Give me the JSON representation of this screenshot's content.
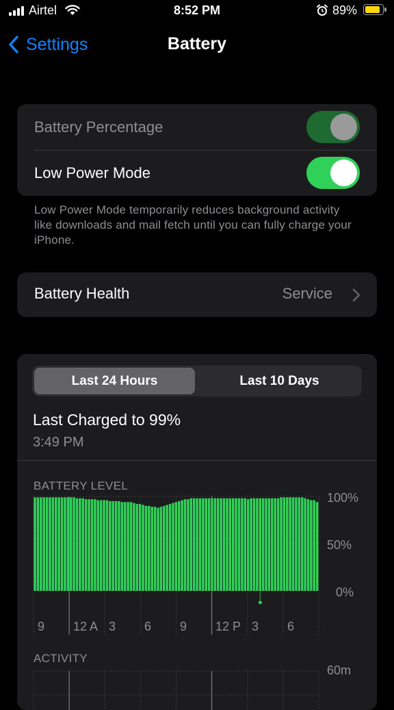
{
  "status_bar": {
    "carrier": "Airtel",
    "time": "8:52 PM",
    "battery_percent": "89%",
    "battery_level": 0.89,
    "battery_color": "#ffd60a"
  },
  "nav": {
    "back_label": "Settings",
    "title": "Battery"
  },
  "settings": {
    "battery_percentage_label": "Battery Percentage",
    "battery_percentage_enabled": true,
    "battery_percentage_disabled_state": true,
    "low_power_mode_label": "Low Power Mode",
    "low_power_mode_enabled": true,
    "low_power_note": "Low Power Mode temporarily reduces background activity like downloads and mail fetch until you can fully charge your iPhone.",
    "battery_health_label": "Battery Health",
    "battery_health_value": "Service"
  },
  "usage": {
    "tabs": [
      "Last 24 Hours",
      "Last 10 Days"
    ],
    "active_tab": 0,
    "last_charged_title": "Last Charged to 99%",
    "last_charged_time": "3:49 PM",
    "battery_level_caption": "BATTERY LEVEL",
    "activity_caption": "ACTIVITY",
    "accent_color": "#30d158"
  },
  "chart_data": [
    {
      "type": "bar",
      "title": "BATTERY LEVEL",
      "ylim": [
        0,
        100
      ],
      "y_tick_labels": [
        "100%",
        "50%",
        "0%"
      ],
      "x_tick_labels": [
        "9",
        "12 A",
        "3",
        "6",
        "9",
        "12 P",
        "3",
        "6"
      ],
      "values": [
        99,
        99,
        99,
        99,
        99,
        99,
        99,
        99,
        99,
        99,
        99,
        99,
        99,
        99,
        98,
        98,
        98,
        97,
        97,
        97,
        97,
        96,
        96,
        96,
        96,
        95,
        95,
        95,
        95,
        94,
        94,
        94,
        94,
        93,
        92,
        92,
        91,
        90,
        90,
        89,
        89,
        88,
        89,
        90,
        91,
        92,
        93,
        94,
        95,
        96,
        97,
        97,
        98,
        98,
        98,
        98,
        98,
        98,
        98,
        98,
        98,
        98,
        98,
        98,
        98,
        98,
        98,
        98,
        98,
        98,
        98,
        97,
        98,
        98,
        98,
        98,
        98,
        98,
        98,
        98,
        98,
        98,
        99,
        99,
        99,
        99,
        99,
        99,
        99,
        99,
        98,
        97,
        96,
        96,
        94
      ],
      "charging_marker_category_index": 75
    },
    {
      "type": "bar",
      "title": "ACTIVITY",
      "y_tick_labels": [
        "60m"
      ],
      "values": []
    }
  ]
}
